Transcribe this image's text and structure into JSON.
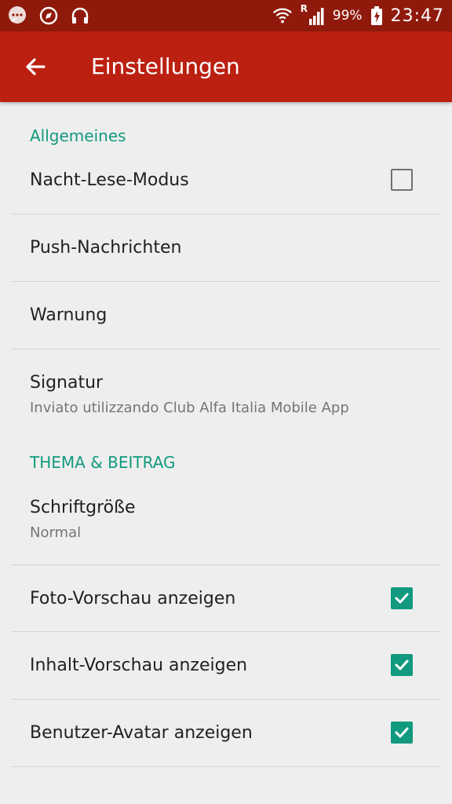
{
  "status_bar": {
    "battery": "99%",
    "time": "23:47",
    "signal_label": "R"
  },
  "app_bar": {
    "title": "Einstellungen"
  },
  "sections": [
    {
      "header": "Allgemeines",
      "items": [
        {
          "title": "Nacht-Lese-Modus",
          "checkbox": "unchecked"
        },
        {
          "title": "Push-Nachrichten"
        },
        {
          "title": "Warnung"
        },
        {
          "title": "Signatur",
          "summary": "Inviato utilizzando Club Alfa Italia Mobile App"
        }
      ]
    },
    {
      "header": "THEMA & BEITRAG",
      "items": [
        {
          "title": "Schriftgröße",
          "summary": "Normal"
        },
        {
          "title": "Foto-Vorschau anzeigen",
          "checkbox": "checked"
        },
        {
          "title": "Inhalt-Vorschau anzeigen",
          "checkbox": "checked"
        },
        {
          "title": "Benutzer-Avatar anzeigen",
          "checkbox": "checked"
        }
      ]
    }
  ],
  "colors": {
    "status_bar": "#8f1a0c",
    "app_bar": "#bb2011",
    "accent": "#129a7f",
    "background": "#eeeeee"
  },
  "icons": {
    "status_left": [
      "chat-bubble-icon",
      "compass-icon",
      "headphones-icon"
    ],
    "status_right": [
      "wifi-icon",
      "signal-icon",
      "battery-charging-icon"
    ],
    "back": "arrow-left-icon",
    "check": "checkmark-icon"
  }
}
